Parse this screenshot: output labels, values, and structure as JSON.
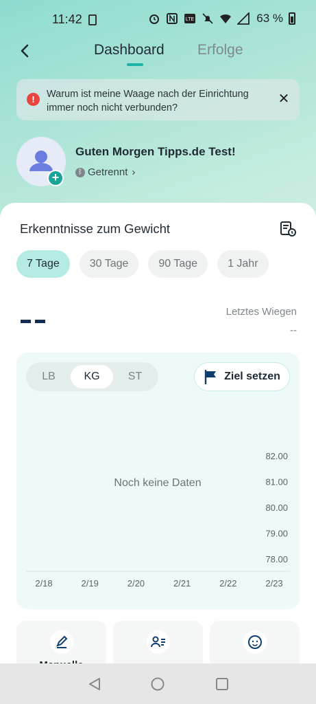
{
  "status_bar": {
    "time": "11:42",
    "battery": "63 %"
  },
  "header": {
    "tabs": [
      {
        "label": "Dashboard",
        "active": true
      },
      {
        "label": "Erfolge",
        "active": false
      }
    ]
  },
  "alert": {
    "text": "Warum ist meine Waage nach der Einrichtung immer noch nicht verbunden?"
  },
  "profile": {
    "greeting": "Guten Morgen Tipps.de Test!",
    "connection": "Getrennt"
  },
  "insights": {
    "title": "Erkenntnisse zum Gewicht",
    "periods": [
      {
        "label": "7 Tage",
        "active": true
      },
      {
        "label": "30 Tage",
        "active": false
      },
      {
        "label": "90 Tage",
        "active": false
      },
      {
        "label": "1 Jahr",
        "active": false
      }
    ],
    "last_weigh_label": "Letztes Wiegen",
    "last_weigh_value": "--"
  },
  "chart_panel": {
    "units": [
      {
        "label": "LB",
        "active": false
      },
      {
        "label": "KG",
        "active": true
      },
      {
        "label": "ST",
        "active": false
      }
    ],
    "goal_button": "Ziel setzen",
    "no_data": "Noch keine Daten"
  },
  "chart_data": {
    "type": "line",
    "x": [
      "2/18",
      "2/19",
      "2/20",
      "2/21",
      "2/22",
      "2/23"
    ],
    "y_ticks": [
      "82.00",
      "81.00",
      "80.00",
      "79.00",
      "78.00"
    ],
    "ylim": [
      78,
      82
    ],
    "series": [],
    "grid": false
  },
  "actions": [
    {
      "label": "Manuelle",
      "icon": "pencil-icon"
    },
    {
      "label": "",
      "icon": "user-list-icon"
    },
    {
      "label": "",
      "icon": "baby-face-icon"
    }
  ],
  "colors": {
    "accent": "#1eb3a7",
    "alert": "#e9453f",
    "goal_flag": "#0f3d6e"
  }
}
